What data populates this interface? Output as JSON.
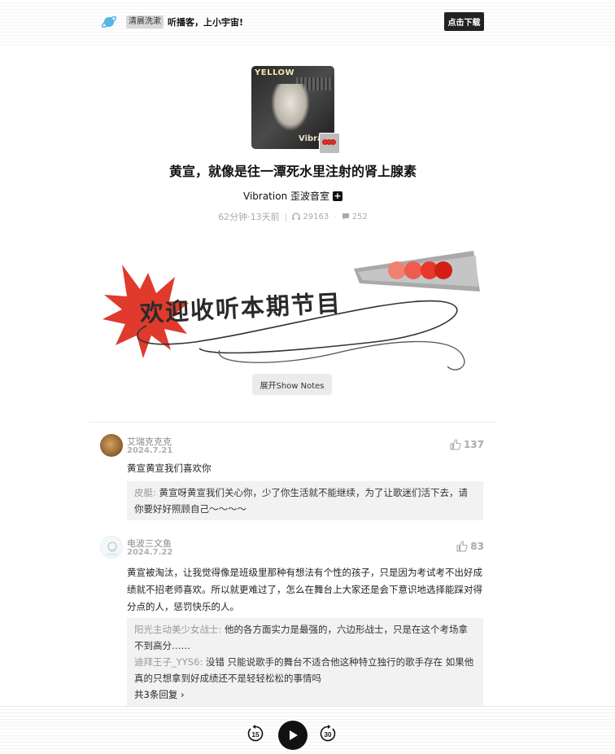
{
  "topbar": {
    "tag": "清晨洗漱",
    "slogan": "听播客，上小宇宙!",
    "download_label": "点击下载"
  },
  "cover": {
    "title_text": "YELLOW",
    "subtitle_text": "Vibration"
  },
  "episode": {
    "title": "黄宣，就像是往一潭死水里注射的肾上腺素",
    "podcast_name": "Vibration 歪波音室",
    "duration": "62分钟",
    "published": "13天前",
    "plays": "29163",
    "comment_count": "252"
  },
  "banner": {
    "text": "欢迎收听本期节目"
  },
  "show_notes_label": "展开Show Notes",
  "comments": [
    {
      "name": "艾瑞克克克",
      "date": "2024.7.21",
      "likes": "137",
      "text": "黄宣黄宣我们喜欢你",
      "replies": [
        {
          "name": "皮艇",
          "text": "黄宣呀黄宣我们关心你，少了你生活就不能继续，为了让歌迷们活下去，请你要好好照顾自己～～～～"
        }
      ]
    },
    {
      "name": "电波三文鱼",
      "date": "2024.7.22",
      "likes": "83",
      "text": "黄宣被淘汰，让我觉得像是班级里那种有想法有个性的孩子，只是因为考试考不出好成绩就不招老师喜欢。所以就更难过了，怎么在舞台上大家还是会下意识地选择能踩对得分点的人，惩罚快乐的人。",
      "replies": [
        {
          "name": "阳光主动美少女战士",
          "text": "他的各方面实力是最强的，六边形战士，只是在这个考场拿不到高分……"
        },
        {
          "name": "迪拜王子_YYS6",
          "text": "没错 只能说歌手的舞台不适合他这种特立独行的歌手存在 如果他真的只想拿到好成绩还不是轻轻松松的事情吗"
        }
      ],
      "more_replies": "共3条回复"
    }
  ],
  "player": {
    "rewind_seconds": "15",
    "forward_seconds": "30"
  }
}
